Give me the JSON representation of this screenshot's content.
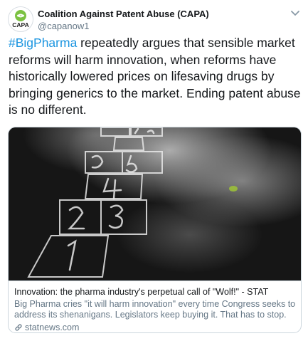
{
  "account": {
    "name": "Coalition Against Patent Abuse (CAPA)",
    "handle": "@capanow1",
    "avatar_text": "CAPA",
    "avatar_icon": "capa-logo-icon"
  },
  "menu_icon": "chevron-down-icon",
  "tweet": {
    "hashtag": "#BigPharma",
    "text": " repeatedly argues that sensible market reforms will harm innovation, when reforms have historically lowered prices on lifesaving drugs by bringing generics to the market. Ending patent abuse is no different."
  },
  "card": {
    "image_icon": "hopscotch-photo",
    "title": "Innovation: the pharma industry's perpetual call of \"Wolf!\" - STAT",
    "description": "Big Pharma cries \"it will harm innovation\" every time Congress seeks to address its shenanigans. Legislators keep buying it. That has to stop.",
    "domain": "statnews.com",
    "domain_icon": "link-icon"
  },
  "colors": {
    "hashtag": "#1b95e0",
    "secondary_text": "#657786",
    "avatar_green": "#7cc242"
  }
}
